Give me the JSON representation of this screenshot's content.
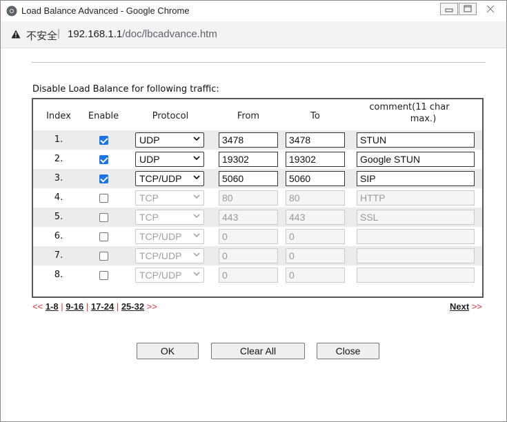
{
  "window": {
    "title": "Load Balance Advanced - Google Chrome"
  },
  "address_bar": {
    "security_label": "不安全",
    "separator": "|",
    "host": "192.168.1.1",
    "path": "/doc/lbcadvance.htm"
  },
  "page": {
    "heading": "Disable Load Balance for following traffic:",
    "columns": {
      "index": "Index",
      "enable": "Enable",
      "protocol": "Protocol",
      "from": "From",
      "to": "To",
      "comment_line1": "comment(11 char",
      "comment_line2": "max.)"
    },
    "rows": [
      {
        "index": "1.",
        "enabled": true,
        "protocol": "UDP",
        "from": "3478",
        "to": "3478",
        "comment": "STUN"
      },
      {
        "index": "2.",
        "enabled": true,
        "protocol": "UDP",
        "from": "19302",
        "to": "19302",
        "comment": "Google STUN"
      },
      {
        "index": "3.",
        "enabled": true,
        "protocol": "TCP/UDP",
        "from": "5060",
        "to": "5060",
        "comment": "SIP"
      },
      {
        "index": "4.",
        "enabled": false,
        "protocol": "TCP",
        "from": "80",
        "to": "80",
        "comment": "HTTP"
      },
      {
        "index": "5.",
        "enabled": false,
        "protocol": "TCP",
        "from": "443",
        "to": "443",
        "comment": "SSL"
      },
      {
        "index": "6.",
        "enabled": false,
        "protocol": "TCP/UDP",
        "from": "0",
        "to": "0",
        "comment": ""
      },
      {
        "index": "7.",
        "enabled": false,
        "protocol": "TCP/UDP",
        "from": "0",
        "to": "0",
        "comment": ""
      },
      {
        "index": "8.",
        "enabled": false,
        "protocol": "TCP/UDP",
        "from": "0",
        "to": "0",
        "comment": ""
      }
    ],
    "pagination": {
      "prev_arrows": "<<",
      "pages": [
        "1-8",
        "9-16",
        "17-24",
        "25-32"
      ],
      "page_sep": "|",
      "next_arrows": ">>",
      "next_label": "Next"
    },
    "buttons": {
      "ok": "OK",
      "clear_all": "Clear All",
      "close": "Close"
    }
  },
  "colors": {
    "checkbox_checked": "#1a73e8",
    "pager_arrows": "#e03030",
    "row_alt": "#ececec"
  }
}
